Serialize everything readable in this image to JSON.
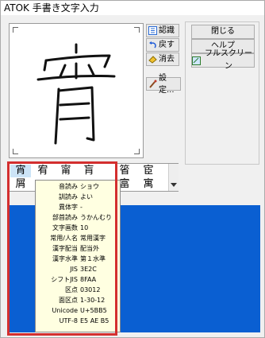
{
  "window": {
    "title": "ATOK 手書き文字入力"
  },
  "side_buttons": {
    "recognize": "認識",
    "undo": "戻す",
    "erase": "消去",
    "settings": "設定..."
  },
  "right_buttons": {
    "close": "閉じる",
    "help": "ヘルプ",
    "fullscreen": "フルスクリーン"
  },
  "candidates": {
    "row1": [
      "宵",
      "宥",
      "甯",
      "肓",
      "箵",
      "宦"
    ],
    "row2": [
      "屑",
      "",
      "",
      "",
      "富",
      "寓"
    ]
  },
  "tooltip": [
    {
      "label": "音読み",
      "value": "ショウ"
    },
    {
      "label": "訓読み",
      "value": "よい"
    },
    {
      "label": "異体字",
      "value": "-"
    },
    {
      "label": "部首読み",
      "value": "うかんむり"
    },
    {
      "label": "文字画数",
      "value": "10"
    },
    {
      "label": "常用/人名",
      "value": "常用漢字"
    },
    {
      "label": "漢字配当",
      "value": "配当外"
    },
    {
      "label": "漢字水準",
      "value": "第１水準"
    },
    {
      "label": "JIS",
      "value": "3E2C"
    },
    {
      "label": "シフトJIS",
      "value": "8FAA"
    },
    {
      "label": "区点",
      "value": "03012"
    },
    {
      "label": "面区点",
      "value": "1-30-12"
    },
    {
      "label": "Unicode",
      "value": "U+5BB5"
    },
    {
      "label": "UTF-8",
      "value": "E5 AE B5"
    }
  ],
  "colors": {
    "selection": "#cce4f7",
    "tooltip_bg": "#ffffe1",
    "highlight_border": "#d32f2f",
    "background_blue": "#0a5fd2"
  }
}
